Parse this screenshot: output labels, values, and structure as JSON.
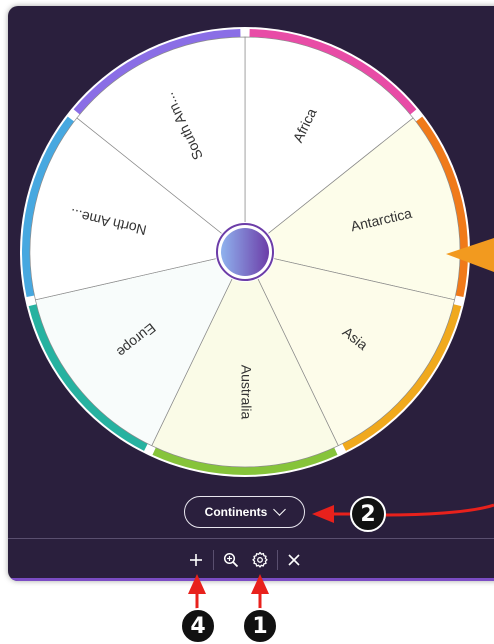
{
  "wheel": {
    "segments": [
      {
        "label": "Africa",
        "fill": "#ffffff",
        "rim": "#e84ca6"
      },
      {
        "label": "Antarctica",
        "fill": "#fdfdea",
        "rim": "#f07a1a"
      },
      {
        "label": "Asia",
        "fill": "#fdfcea",
        "rim": "#f0a91d"
      },
      {
        "label": "Australia",
        "fill": "#fafbe7",
        "rim": "#86c43a"
      },
      {
        "label": "Europe",
        "fill": "#f8fcfb",
        "rim": "#27b2a0"
      },
      {
        "label": "North Ame...",
        "fill": "#ffffff",
        "rim": "#47a8e0"
      },
      {
        "label": "South Am...",
        "fill": "#ffffff",
        "rim": "#8a6ee6"
      }
    ],
    "hub_colors": [
      "#8fb2ee",
      "#6c3da8"
    ],
    "pointer_color": "#f29a1f"
  },
  "dropdown": {
    "label": "Continents"
  },
  "toolbar": {
    "add_icon": "plus-icon",
    "zoom_icon": "zoom-in-icon",
    "settings_icon": "gear-icon",
    "close_icon": "close-icon"
  },
  "annotations": [
    {
      "number": "2"
    },
    {
      "number": "4"
    },
    {
      "number": "1"
    }
  ],
  "colors": {
    "panel": "#2a1f3d",
    "accent_border": "#7b4cc4",
    "annotation_arrow": "#e8211c"
  }
}
